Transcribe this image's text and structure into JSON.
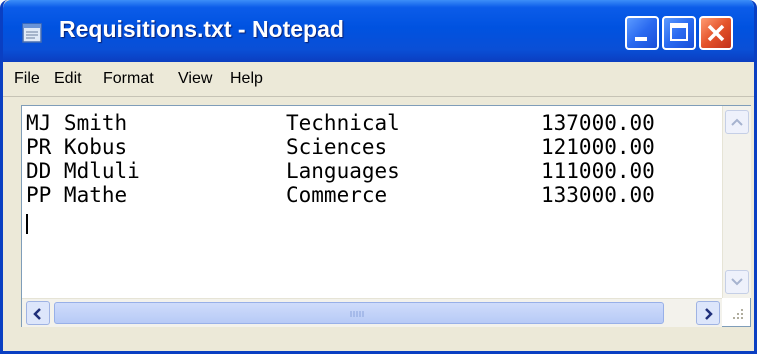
{
  "window": {
    "title": "Requisitions.txt - Notepad"
  },
  "menu": [
    "File",
    "Edit",
    "Format",
    "View",
    "Help"
  ],
  "rows": [
    {
      "name": "MJ Smith",
      "dept": "Technical",
      "amount": "137000.00"
    },
    {
      "name": "PR Kobus",
      "dept": "Sciences",
      "amount": "121000.00"
    },
    {
      "name": "DD Mdluli",
      "dept": "Languages",
      "amount": "111000.00"
    },
    {
      "name": "PP Mathe",
      "dept": "Commerce",
      "amount": "133000.00"
    }
  ],
  "icons": {
    "app": "notepad-icon",
    "minimize": "minimize-icon",
    "maximize": "maximize-icon",
    "close": "close-icon",
    "scroll_up": "chevron-up-icon",
    "scroll_down": "chevron-down-icon",
    "scroll_left": "chevron-left-icon",
    "scroll_right": "chevron-right-icon"
  },
  "colors": {
    "titlebar": "#0054e3",
    "close_button": "#e0461f",
    "menubar": "#ece9d8"
  }
}
